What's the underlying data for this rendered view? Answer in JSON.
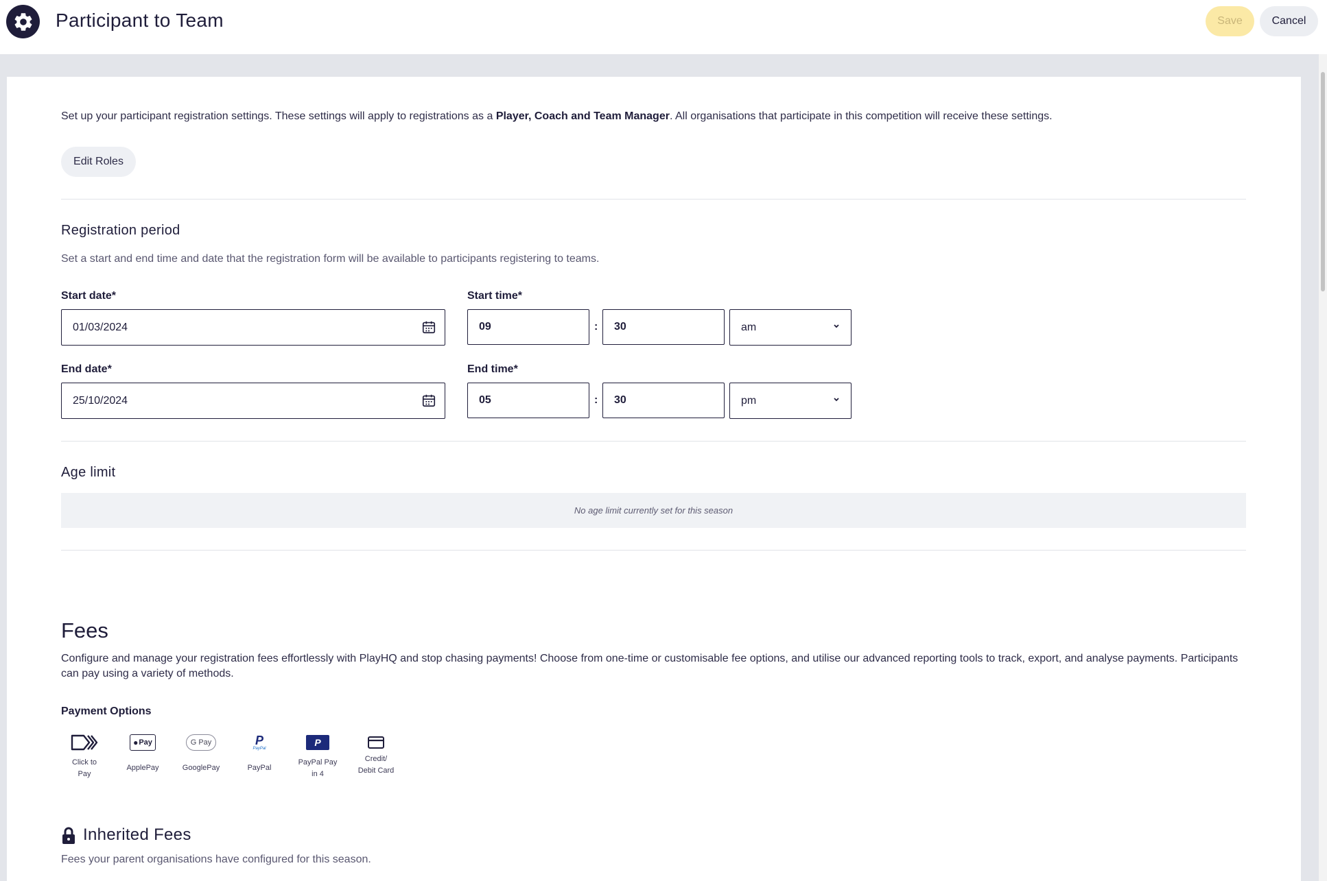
{
  "header": {
    "title": "Participant to Team",
    "save_label": "Save",
    "cancel_label": "Cancel"
  },
  "intro": {
    "text_before": "Set up your participant registration settings. These settings will apply to registrations as a ",
    "text_bold": "Player, Coach and Team Manager",
    "text_after": ". All organisations that participate in this competition will receive these settings.",
    "edit_roles_label": "Edit Roles"
  },
  "registration_period": {
    "heading": "Registration period",
    "description": "Set a start and end time and date that the registration form will be available to participants registering to teams.",
    "start_date_label": "Start date*",
    "start_date_value": "01/03/2024",
    "start_time_label": "Start time*",
    "start_hour": "09",
    "start_minute": "30",
    "start_ampm": "am",
    "end_date_label": "End date*",
    "end_date_value": "25/10/2024",
    "end_time_label": "End time*",
    "end_hour": "05",
    "end_minute": "30",
    "end_ampm": "pm",
    "colon": ":"
  },
  "age_limit": {
    "heading": "Age limit",
    "empty_message": "No age limit currently set for this season"
  },
  "fees": {
    "heading": "Fees",
    "description": "Configure and manage your registration fees effortlessly with PlayHQ and stop chasing payments! Choose from one-time or customisable fee options, and utilise our advanced reporting tools to track, export, and analyse payments. Participants can pay using a variety of methods.",
    "payment_options_label": "Payment Options",
    "payment_options": [
      {
        "label_line1": "Click to",
        "label_line2": "Pay",
        "icon": "click-to-pay-icon"
      },
      {
        "label_line1": "ApplePay",
        "label_line2": "",
        "icon": "apple-pay-icon"
      },
      {
        "label_line1": "GooglePay",
        "label_line2": "",
        "icon": "google-pay-icon"
      },
      {
        "label_line1": "PayPal",
        "label_line2": "",
        "icon": "paypal-icon"
      },
      {
        "label_line1": "PayPal Pay",
        "label_line2": "in 4",
        "icon": "paypal-pay-in-4-icon"
      },
      {
        "label_line1": "Credit/",
        "label_line2": "Debit Card",
        "icon": "credit-card-icon"
      }
    ],
    "apple_pay_text": "Pay",
    "google_pay_text": "G Pay",
    "paypal_small_text": "PayPal"
  },
  "inherited_fees": {
    "heading": "Inherited Fees",
    "description": "Fees your parent organisations have configured for this season."
  },
  "colors": {
    "primary_dark": "#1f1d3a",
    "save_disabled_bg": "#fbe9a6",
    "paypal_blue": "#1c2a7a"
  }
}
